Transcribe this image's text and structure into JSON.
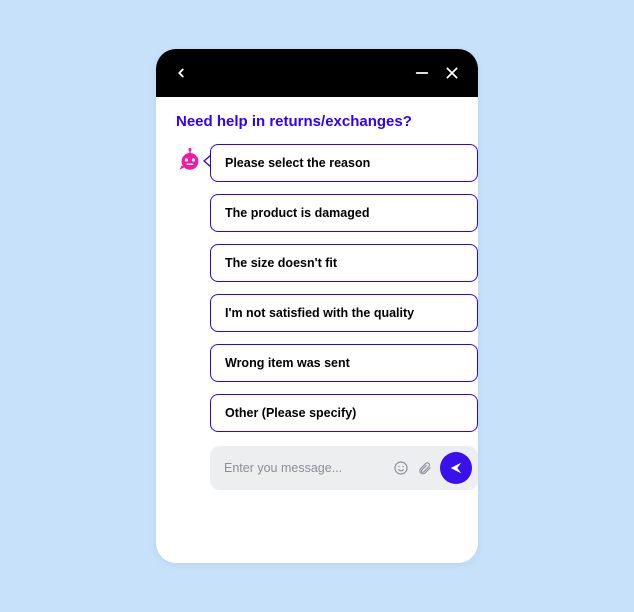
{
  "chat": {
    "title": "Need help in returns/exchanges?",
    "bot_message": "Please select the reason",
    "options": [
      "The product is damaged",
      "The size doesn't fit",
      "I'm not satisfied with the quality",
      "Wrong item was sent",
      "Other (Please specify)"
    ],
    "input": {
      "placeholder": "Enter you message...",
      "value": ""
    }
  },
  "colors": {
    "accent": "#2f00ff",
    "bot": "#ef1aa1",
    "send": "#3a11ea"
  }
}
